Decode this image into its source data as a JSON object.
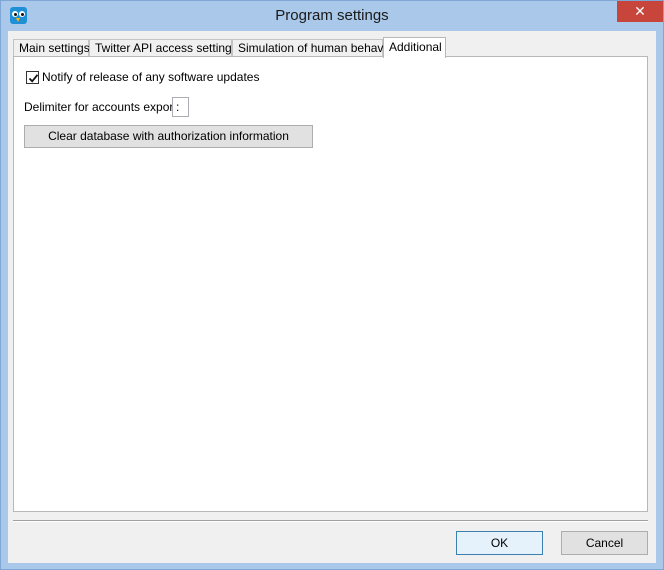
{
  "window": {
    "title": "Program settings",
    "close_glyph": "✕",
    "icon": "owl-app-icon"
  },
  "tabs": [
    {
      "label": "Main settings",
      "active": false
    },
    {
      "label": "Twitter API access settings",
      "active": false
    },
    {
      "label": "Simulation of human behavior",
      "active": false
    },
    {
      "label": "Additional",
      "active": true
    }
  ],
  "additional": {
    "notify_label": "Notify of release of any software updates",
    "notify_checked": true,
    "delimiter_label": "Delimiter for accounts export:",
    "delimiter_value": ":",
    "clear_db_label": "Clear database with authorization information"
  },
  "footer": {
    "ok_label": "OK",
    "cancel_label": "Cancel"
  },
  "colors": {
    "frame": "#a9c8ea",
    "close_button": "#c7453a",
    "default_button_border": "#3c7fb1"
  }
}
